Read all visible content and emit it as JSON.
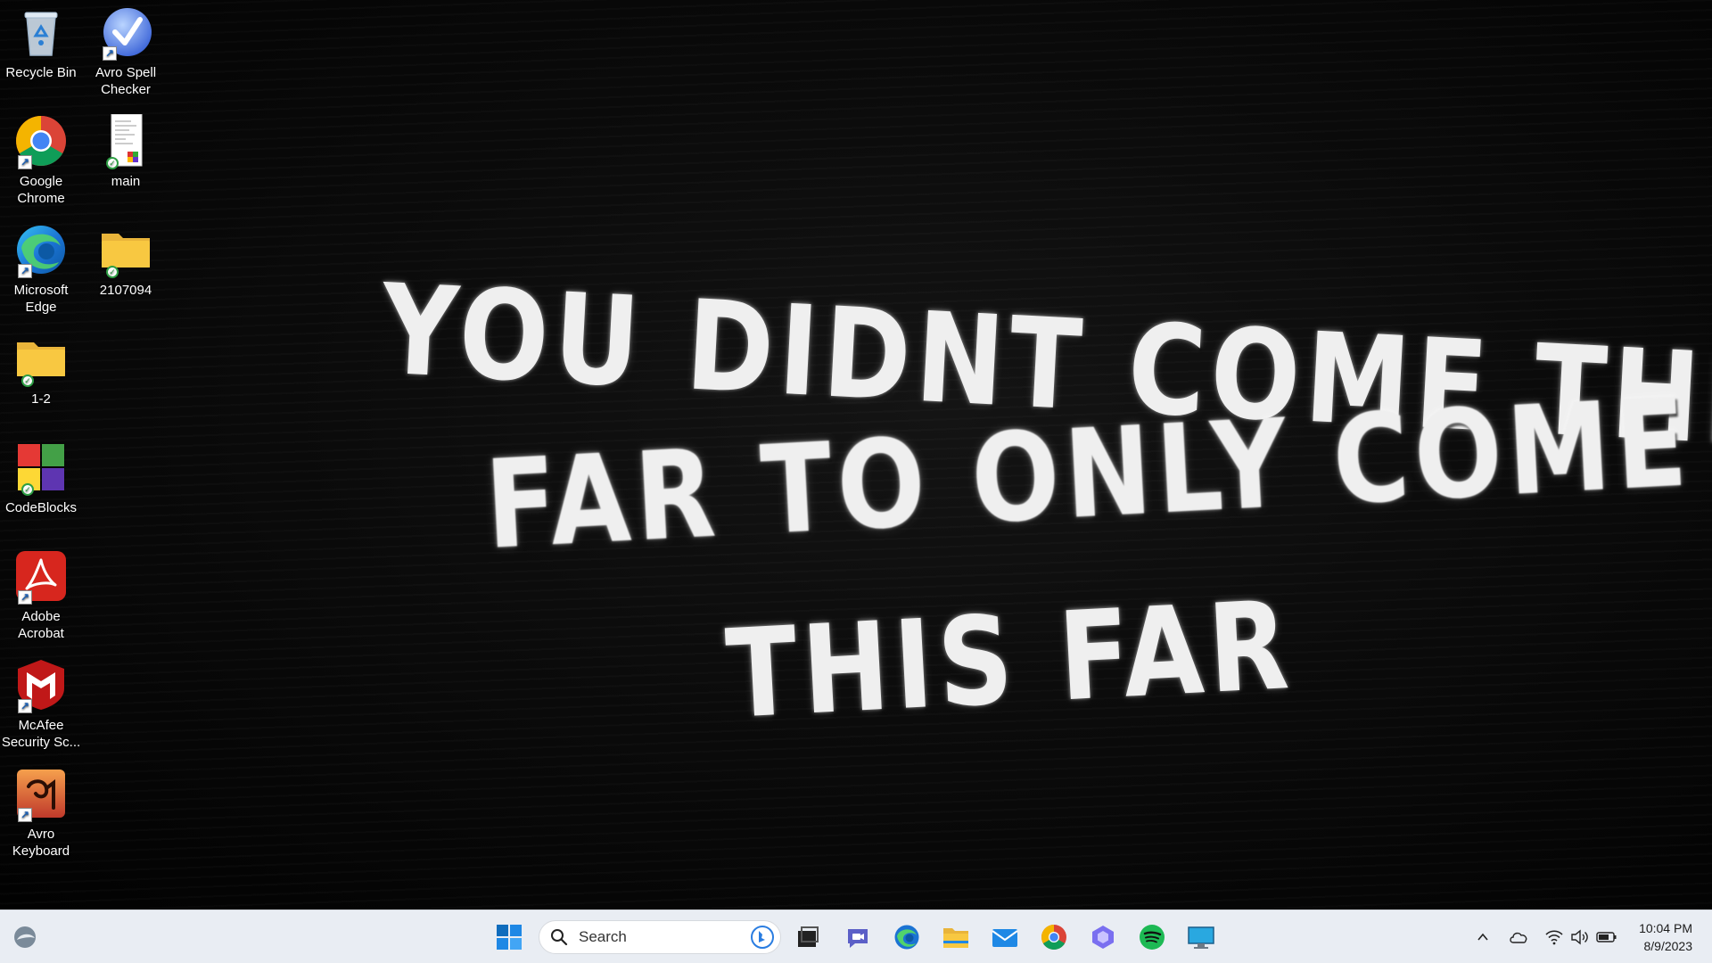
{
  "wallpaper": {
    "line1": "YOU DIDNT COME THIS",
    "line2": "FAR TO ONLY COME",
    "line3": "THIS FAR"
  },
  "desktop_icons": [
    {
      "label": "Recycle Bin",
      "icon": "recycle-bin-icon"
    },
    {
      "label": "Avro Spell Checker",
      "icon": "avro-spell-checker-icon"
    },
    {
      "label": "Google Chrome",
      "icon": "chrome-icon"
    },
    {
      "label": "main",
      "icon": "document-icon"
    },
    {
      "label": "Microsoft Edge",
      "icon": "edge-icon"
    },
    {
      "label": "2107094",
      "icon": "folder-icon"
    },
    {
      "label": "1-2",
      "icon": "folder-icon"
    },
    {
      "label": "CodeBlocks",
      "icon": "codeblocks-icon"
    },
    {
      "label": "Adobe Acrobat",
      "icon": "acrobat-icon"
    },
    {
      "label": "McAfee Security Sc...",
      "icon": "mcafee-icon"
    },
    {
      "label": "Avro Keyboard",
      "icon": "avro-keyboard-icon"
    }
  ],
  "taskbar": {
    "search_placeholder": "Search",
    "pinned": [
      "start-icon",
      "task-view-icon",
      "teams-icon",
      "edge-icon",
      "file-explorer-icon",
      "mail-icon",
      "chrome-icon",
      "copilot-icon",
      "spotify-icon",
      "remote-desktop-icon"
    ],
    "clock": {
      "time": "10:04 PM",
      "date": "8/9/2023"
    }
  },
  "colors": {
    "taskbar_bg": "#e9edf3",
    "folder_yellow": "#f8c841",
    "windows_blue": "#0f6cbd"
  }
}
